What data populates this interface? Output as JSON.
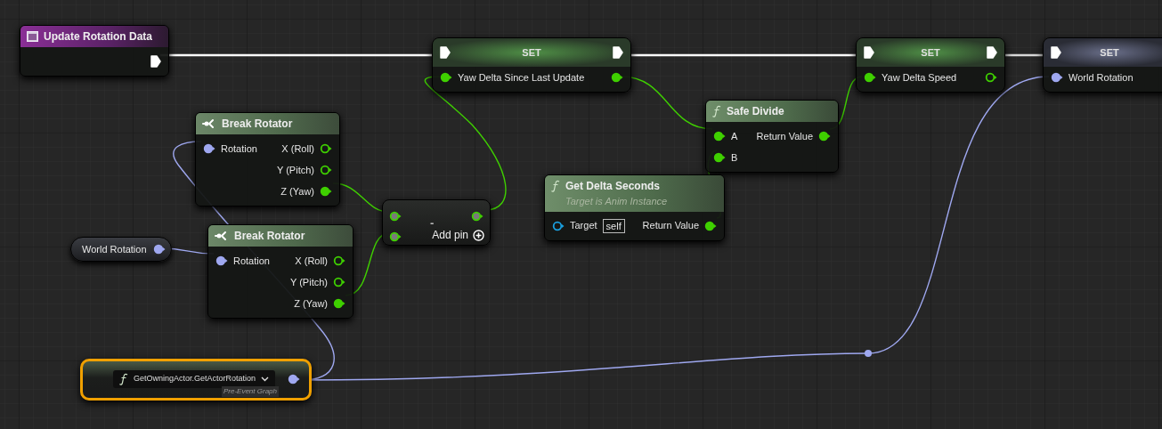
{
  "graph": {
    "nodes": [
      {
        "kind": "event",
        "title": "Update Rotation Data",
        "rows": [
          {
            "out": {
              "kind": "exec",
              "connected": true
            }
          }
        ]
      },
      {
        "kind": "set",
        "title": "SET",
        "exec_in": {
          "kind": "exec",
          "connected": true
        },
        "exec_out": {
          "kind": "exec",
          "connected": true
        },
        "rows": [
          {
            "in": {
              "kind": "float",
              "label": "Yaw Delta Since Last Update",
              "connected": true
            },
            "out": {
              "kind": "float",
              "connected": true
            }
          }
        ]
      },
      {
        "kind": "set",
        "title": "SET",
        "exec_in": {
          "kind": "exec",
          "connected": true
        },
        "exec_out": {
          "kind": "exec",
          "connected": true
        },
        "rows": [
          {
            "in": {
              "kind": "float",
              "label": "Yaw Delta Speed",
              "connected": true
            },
            "out": {
              "kind": "float",
              "connected": false
            }
          }
        ]
      },
      {
        "kind": "set",
        "title": "SET",
        "exec_in": {
          "kind": "exec",
          "connected": true
        },
        "rows": [
          {
            "in": {
              "kind": "rotator",
              "label": "World Rotation",
              "connected": true
            }
          }
        ]
      },
      {
        "kind": "function",
        "title": "Safe Divide",
        "rows": [
          {
            "in": {
              "kind": "float",
              "label": "A",
              "connected": true
            },
            "out": {
              "kind": "float",
              "label": "Return Value",
              "connected": true
            }
          },
          {
            "in": {
              "kind": "float",
              "label": "B",
              "connected": true
            }
          }
        ]
      },
      {
        "kind": "function",
        "title": "Get Delta Seconds",
        "subtitle": "Target is Anim Instance",
        "rows": [
          {
            "in": {
              "kind": "object",
              "label": "Target",
              "default": "self",
              "connected": false
            },
            "out": {
              "kind": "float",
              "label": "Return Value",
              "connected": true
            }
          }
        ]
      },
      {
        "kind": "break",
        "title": "Break Rotator",
        "rows": [
          {
            "in": {
              "kind": "rotator",
              "label": "Rotation",
              "connected": true
            },
            "out": {
              "kind": "float",
              "label": "X (Roll)",
              "connected": false
            }
          },
          {
            "out": {
              "kind": "float",
              "label": "Y (Pitch)",
              "connected": false
            }
          },
          {
            "out": {
              "kind": "float",
              "label": "Z (Yaw)",
              "connected": true
            }
          }
        ]
      },
      {
        "kind": "break",
        "title": "Break Rotator",
        "rows": [
          {
            "in": {
              "kind": "rotator",
              "label": "Rotation",
              "connected": true
            },
            "out": {
              "kind": "float",
              "label": "X (Roll)",
              "connected": false
            }
          },
          {
            "out": {
              "kind": "float",
              "label": "Y (Pitch)",
              "connected": false
            }
          },
          {
            "out": {
              "kind": "float",
              "label": "Z (Yaw)",
              "connected": true
            }
          }
        ]
      },
      {
        "kind": "math",
        "operator": "-",
        "add_pin": "Add pin",
        "rows": [
          {
            "in": {
              "kind": "wildcard",
              "connected": true
            },
            "out": {
              "kind": "wildcard",
              "connected": true
            }
          },
          {
            "in": {
              "kind": "wildcard",
              "connected": true
            }
          }
        ]
      },
      {
        "kind": "getter",
        "title": "World Rotation",
        "rows": [
          {
            "out": {
              "kind": "rotator",
              "connected": true
            }
          }
        ]
      },
      {
        "kind": "access",
        "title": "GetOwningActor.GetActorRotation",
        "footer": "Pre-Event Graph",
        "selected": true,
        "rows": [
          {
            "out": {
              "kind": "rotator",
              "connected": true
            }
          }
        ]
      }
    ]
  }
}
